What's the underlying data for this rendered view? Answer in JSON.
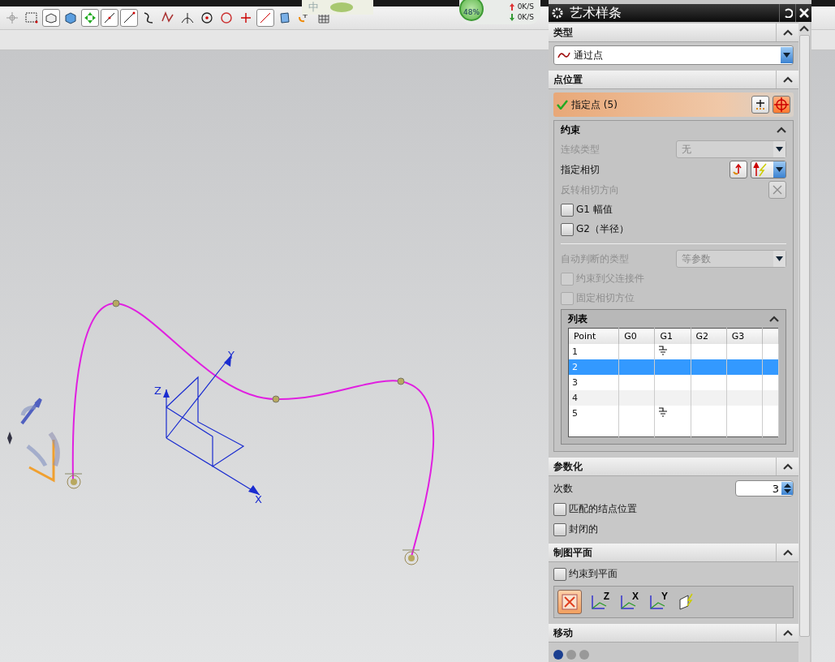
{
  "viewport_labels": {
    "x_axis": "X",
    "y_axis": "Y",
    "z_axis": "Z"
  },
  "ime_popup": {
    "char": "中"
  },
  "net_widget": {
    "percent": "48%",
    "up_rate": "0K/S",
    "down_rate": "0K/S"
  },
  "dialog": {
    "title": "艺术样条",
    "sections": [
      {
        "kind": "type",
        "title": "类型",
        "expanded": true,
        "value": "通过点"
      },
      {
        "kind": "points",
        "title": "点位置",
        "expanded": true,
        "selector": {
          "label": "指定点 (5)",
          "done": true
        },
        "constraints": {
          "title": "约束",
          "expanded": true,
          "rows": [
            {
              "kind": "select",
              "label": "连续类型",
              "value": "无",
              "disabled": true
            },
            {
              "kind": "tangent",
              "label": "指定相切",
              "disabled": false
            },
            {
              "kind": "action",
              "label": "反转相切方向",
              "disabled": true
            },
            {
              "kind": "checkbox",
              "label": "G1 幅值",
              "checked": false,
              "disabled": false
            },
            {
              "kind": "checkbox",
              "label": "G2（半径）",
              "checked": false,
              "disabled": false
            },
            {
              "kind": "divider"
            },
            {
              "kind": "select",
              "label": "自动判断的类型",
              "value": "等参数",
              "disabled": true
            },
            {
              "kind": "checkbox",
              "label": "约束到父连接件",
              "checked": false,
              "disabled": true
            },
            {
              "kind": "checkbox",
              "label": "固定相切方位",
              "checked": false,
              "disabled": true
            }
          ],
          "list": {
            "title": "列表",
            "expanded": true,
            "columns": [
              "Point",
              "G0",
              "G1",
              "G2",
              "G3"
            ],
            "rows": [
              {
                "point": "1",
                "g1_constraint": true,
                "selected": false
              },
              {
                "point": "2",
                "g1_constraint": false,
                "selected": true
              },
              {
                "point": "3",
                "g1_constraint": false,
                "selected": false
              },
              {
                "point": "4",
                "g1_constraint": false,
                "selected": false
              },
              {
                "point": "5",
                "g1_constraint": true,
                "selected": false
              }
            ]
          }
        }
      },
      {
        "kind": "params",
        "title": "参数化",
        "expanded": true,
        "degree_label": "次数",
        "degree": "3",
        "checkboxes": [
          {
            "label": "匹配的结点位置",
            "checked": false
          },
          {
            "label": "封闭的",
            "checked": false
          }
        ]
      },
      {
        "kind": "plane",
        "title": "制图平面",
        "expanded": true,
        "checkbox": {
          "label": "约束到平面",
          "checked": false
        },
        "options": [
          {
            "kind": "auto",
            "selected": true
          },
          {
            "kind": "axis",
            "label": "Z",
            "selected": false
          },
          {
            "kind": "axis",
            "label": "X",
            "selected": false
          },
          {
            "kind": "axis",
            "label": "Y",
            "selected": false
          },
          {
            "kind": "custom",
            "selected": false
          }
        ]
      },
      {
        "kind": "move",
        "title": "移动",
        "expanded": true,
        "options": [
          {
            "selected": true
          },
          {
            "selected": false
          },
          {
            "selected": false
          }
        ]
      }
    ]
  }
}
